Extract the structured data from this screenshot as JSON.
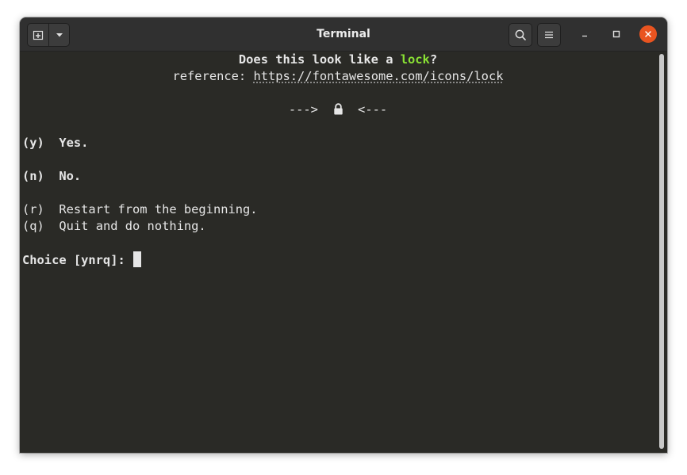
{
  "window": {
    "title": "Terminal"
  },
  "header": {
    "new_tab_icon": "new-tab-icon",
    "tab_menu_icon": "chevron-down-icon",
    "search_icon": "search-icon",
    "menu_icon": "hamburger-menu-icon",
    "minimize_icon": "minimize-icon",
    "maximize_icon": "maximize-icon",
    "close_icon": "close-icon",
    "close_color": "#e95420"
  },
  "terminal": {
    "question_prefix": "Does this look like a ",
    "question_word": "lock",
    "question_suffix": "?",
    "reference_label": "reference: ",
    "reference_url": "https://fontawesome.com/icons/lock",
    "arrow_left": "--->",
    "arrow_right": "<---",
    "preview_icon": "lock-icon",
    "options": [
      {
        "key": "(y)",
        "label": "Yes."
      },
      {
        "key": "(n)",
        "label": "No."
      },
      {
        "key": "(r)",
        "label": "Restart from the beginning."
      },
      {
        "key": "(q)",
        "label": "Quit and do nothing."
      }
    ],
    "prompt": "Choice [ynrq]: ",
    "accent_color": "#8ae234",
    "background_color": "#2a2a26"
  }
}
